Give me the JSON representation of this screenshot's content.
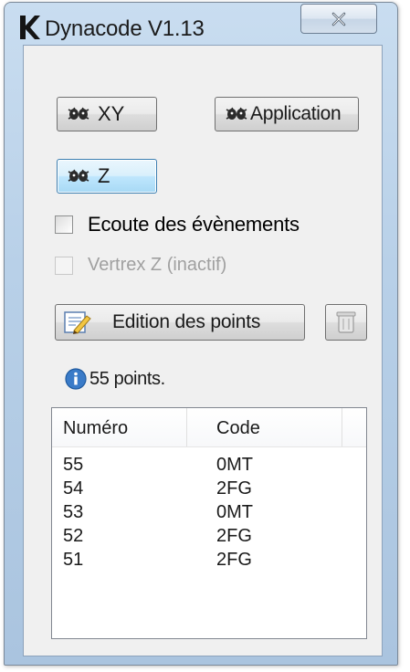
{
  "window": {
    "title": "Dynacode V1.13",
    "logo_letter": "K",
    "close_icon": "close-icon"
  },
  "buttons": {
    "xy_label": "XY",
    "application_label": "Application",
    "z_label": "Z",
    "edition_label": "Edition des points",
    "icon": "bugs-icon"
  },
  "options": {
    "ecoute_label": "Ecoute des évènements",
    "ecoute_checked": false,
    "vertex_label": "Vertrex Z (inactif)",
    "vertex_enabled": false,
    "vertex_checked": false
  },
  "status": {
    "text": "55 points."
  },
  "table": {
    "columns": [
      "Numéro",
      "Code"
    ],
    "rows": [
      {
        "numero": "55",
        "code": "0MT"
      },
      {
        "numero": "54",
        "code": "2FG"
      },
      {
        "numero": "53",
        "code": "0MT"
      },
      {
        "numero": "52",
        "code": "2FG"
      },
      {
        "numero": "51",
        "code": "2FG"
      }
    ]
  },
  "colors": {
    "frame": "#b8d0e8",
    "focus": "#3c7fb1",
    "info_blue": "#3a7bc8"
  }
}
